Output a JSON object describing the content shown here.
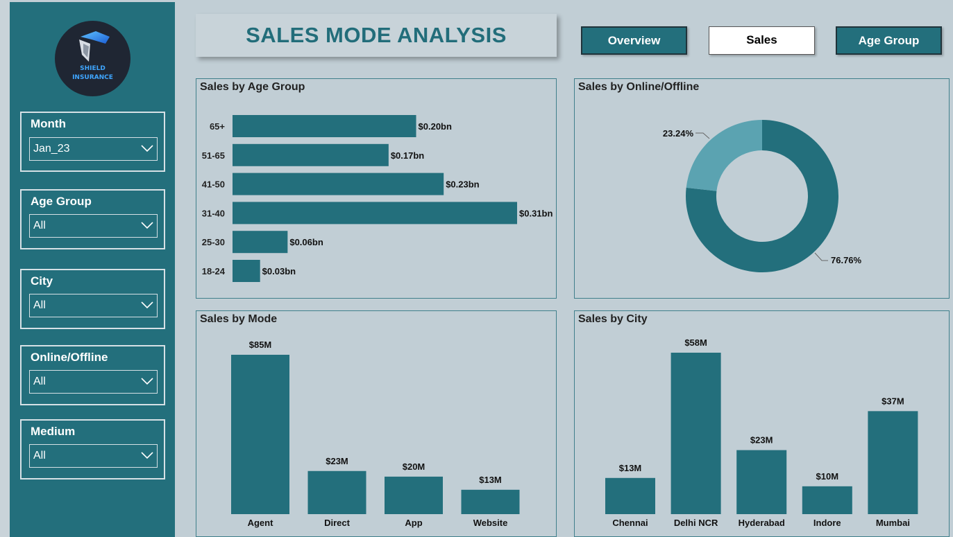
{
  "logo": {
    "line1": "SHIELD",
    "line2": "INSURANCE"
  },
  "title": "SALES MODE ANALYSIS",
  "nav": [
    {
      "label": "Overview",
      "active": false
    },
    {
      "label": "Sales",
      "active": true
    },
    {
      "label": "Age Group",
      "active": false
    }
  ],
  "slicers": [
    {
      "title": "Month",
      "value": "Jan_23"
    },
    {
      "title": "Age Group",
      "value": "All"
    },
    {
      "title": "City",
      "value": "All"
    },
    {
      "title": "Online/Offline",
      "value": "All"
    },
    {
      "title": "Medium",
      "value": "All"
    }
  ],
  "colors": {
    "sidebar": "#236f7c",
    "bar": "#236f7c",
    "donut_light": "#5ba3b1",
    "background": "#c1ced5"
  },
  "chart_data": [
    {
      "type": "bar",
      "orientation": "horizontal",
      "title": "Sales by Age Group",
      "categories": [
        "65+",
        "51-65",
        "41-50",
        "31-40",
        "25-30",
        "18-24"
      ],
      "values": [
        0.2,
        0.17,
        0.23,
        0.31,
        0.06,
        0.03
      ],
      "labels": [
        "$0.20bn",
        "$0.17bn",
        "$0.23bn",
        "$0.31bn",
        "$0.06bn",
        "$0.03bn"
      ]
    },
    {
      "type": "pie",
      "title": "Sales by Online/Offline",
      "values": [
        76.76,
        23.24
      ],
      "labels": [
        "76.76%",
        "23.24%"
      ]
    },
    {
      "type": "bar",
      "title": "Sales by Mode",
      "categories": [
        "Agent",
        "Direct",
        "App",
        "Website"
      ],
      "values": [
        85,
        23,
        20,
        13
      ],
      "labels": [
        "$85M",
        "$23M",
        "$20M",
        "$13M"
      ]
    },
    {
      "type": "bar",
      "title": "Sales by City",
      "categories": [
        "Chennai",
        "Delhi NCR",
        "Hyderabad",
        "Indore",
        "Mumbai"
      ],
      "values": [
        13,
        58,
        23,
        10,
        37
      ],
      "labels": [
        "$13M",
        "$58M",
        "$23M",
        "$10M",
        "$37M"
      ]
    }
  ]
}
